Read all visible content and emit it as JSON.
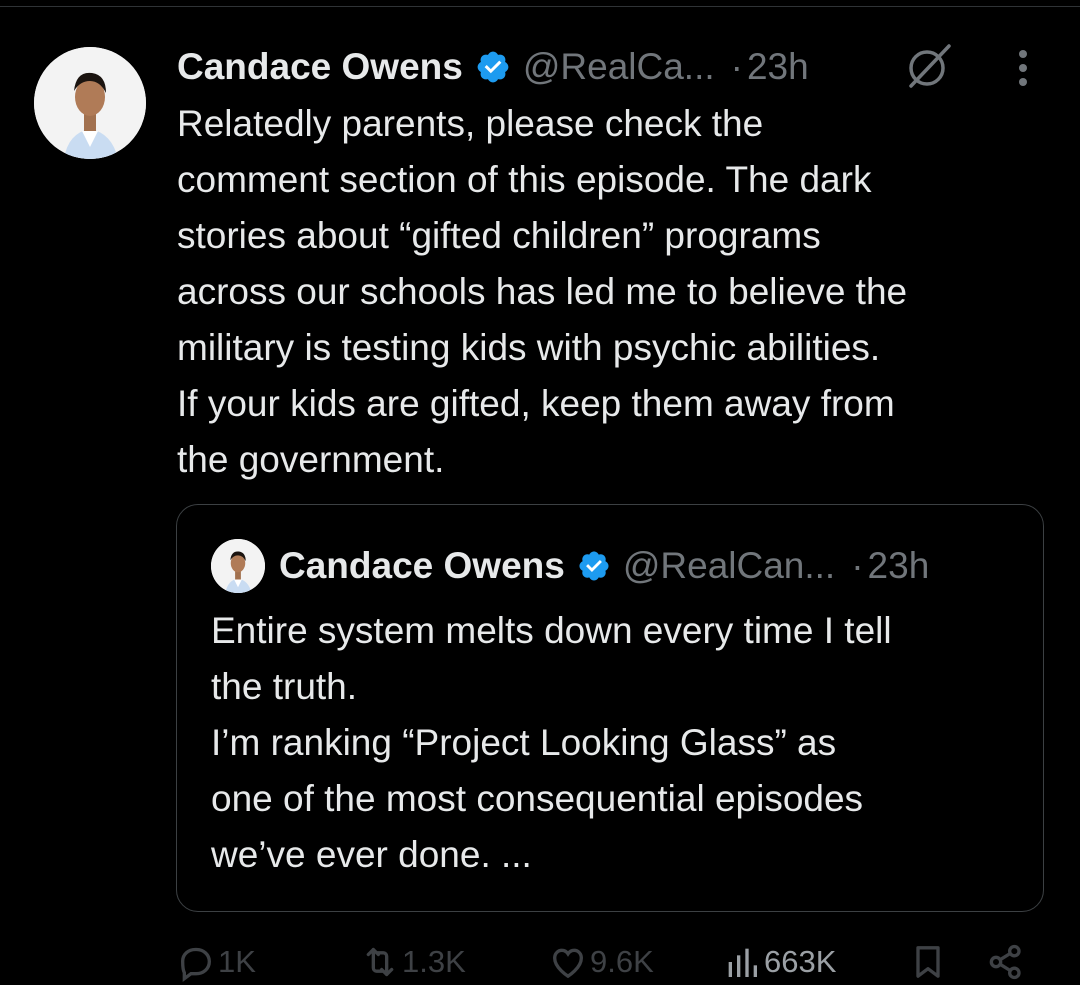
{
  "tweet": {
    "display_name": "Candace Owens",
    "handle": "@RealCa...",
    "separator": "·",
    "time": "23h",
    "text_lines": [
      "Relatedly parents, please check the",
      "comment section of this episode. The dark",
      "stories about “gifted children” programs",
      "across our schools has led me to believe the",
      "military is testing kids with psychic abilities.",
      "If your kids are gifted, keep them away from",
      "the government."
    ]
  },
  "quote": {
    "display_name": "Candace Owens",
    "handle": "@RealCan...",
    "separator": "·",
    "time": "23h",
    "text_lines": [
      "Entire system melts down every time I tell",
      "the truth.",
      "I’m ranking “Project Looking Glass” as",
      "one of the most consequential episodes",
      "we’ve ever done. ..."
    ]
  },
  "actions": {
    "replies": "1K",
    "reposts": "1.3K",
    "likes": "9.6K",
    "views": "663K"
  },
  "icons": {
    "verified": "verified-badge-icon",
    "grok": "grok-icon",
    "more": "more-vertical-icon",
    "reply": "reply-icon",
    "repost": "repost-icon",
    "like": "heart-icon",
    "views": "views-chart-icon",
    "bookmark": "bookmark-icon",
    "share": "share-icon"
  },
  "colors": {
    "background": "#000000",
    "text_primary": "#e7e9ea",
    "text_secondary": "#71767b",
    "verified_blue": "#1d9bf0",
    "border": "#3c4043"
  }
}
